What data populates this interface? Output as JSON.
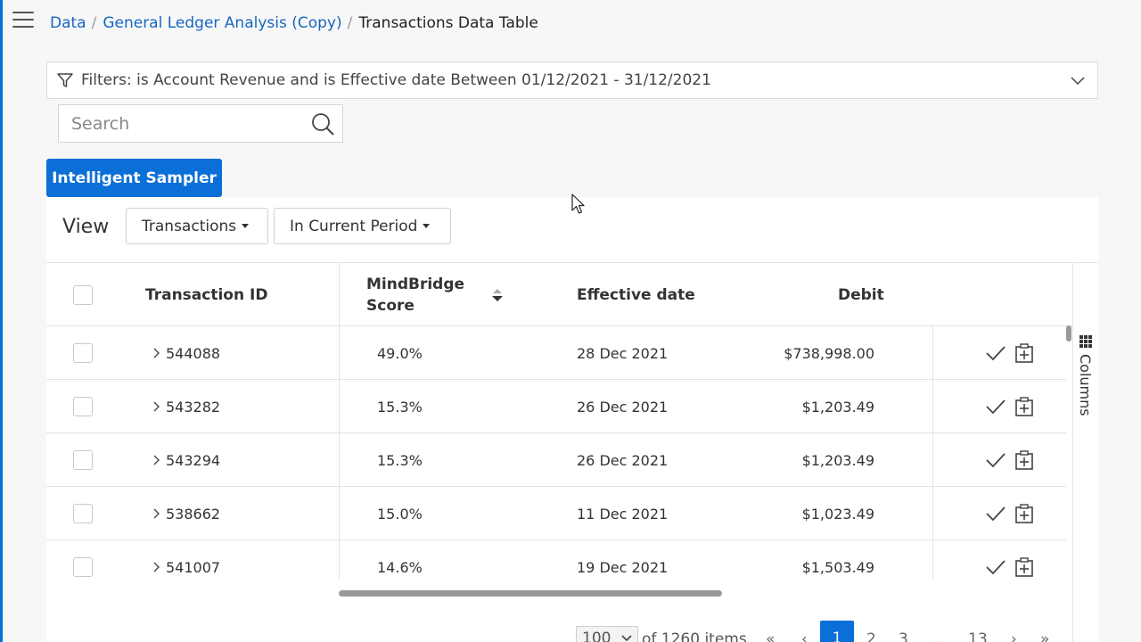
{
  "breadcrumb": {
    "items": [
      "Data",
      "General Ledger Analysis (Copy)"
    ],
    "separator": "/",
    "current": "Transactions Data Table"
  },
  "filter": {
    "text": "Filters: is Account Revenue and is Effective date Between 01/12/2021 - 31/12/2021"
  },
  "search": {
    "placeholder": "Search"
  },
  "sampler_button": "Intelligent Sampler",
  "view": {
    "label": "View",
    "dropdown1": "Transactions",
    "dropdown2": "In Current Period"
  },
  "table": {
    "headers": {
      "transaction_id": "Transaction ID",
      "score_line1": "MindBridge",
      "score_line2": "Score",
      "effective_date": "Effective date",
      "debit": "Debit"
    },
    "rows": [
      {
        "id": "544088",
        "score": "49.0%",
        "date": "28 Dec 2021",
        "debit": "$738,998.00"
      },
      {
        "id": "543282",
        "score": "15.3%",
        "date": "26 Dec 2021",
        "debit": "$1,203.49"
      },
      {
        "id": "543294",
        "score": "15.3%",
        "date": "26 Dec 2021",
        "debit": "$1,203.49"
      },
      {
        "id": "538662",
        "score": "15.0%",
        "date": "11 Dec 2021",
        "debit": "$1,023.49"
      },
      {
        "id": "541007",
        "score": "14.6%",
        "date": "19 Dec 2021",
        "debit": "$1,503.49"
      }
    ]
  },
  "columns_tab": "Columns",
  "pagination": {
    "page_size": "100",
    "of_items": "of 1260 items",
    "pages": [
      "1",
      "2",
      "3"
    ],
    "ellipsis": "...",
    "last_page": "13"
  },
  "colors": {
    "accent": "#0a6fd6",
    "link": "#1766c2"
  }
}
